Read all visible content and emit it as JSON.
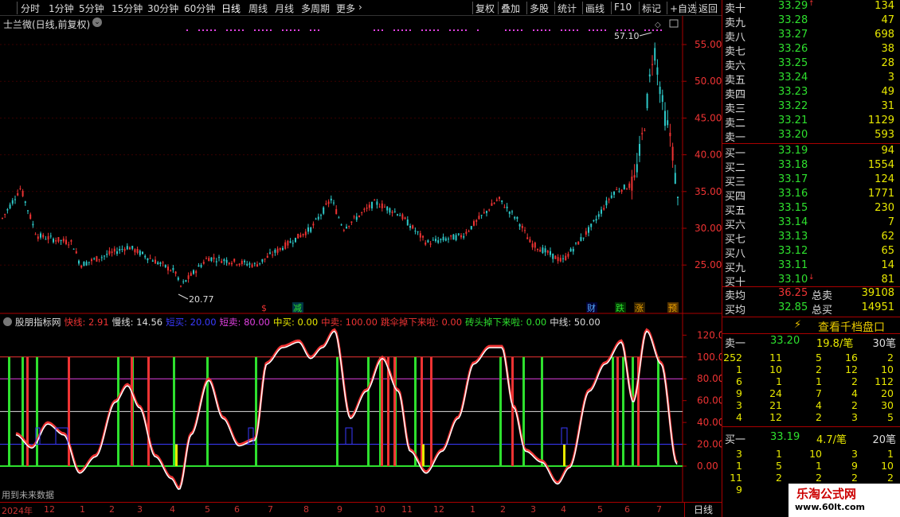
{
  "toolbar": {
    "periods": [
      "分时",
      "1分钟",
      "5分钟",
      "15分钟",
      "30分钟",
      "60分钟",
      "日线",
      "周线",
      "月线",
      "多周期",
      "更多"
    ],
    "active_period": "日线",
    "right_buttons": [
      "复权",
      "叠加",
      "多股",
      "统计",
      "画线",
      "F10",
      "标记",
      "+自选",
      "返回"
    ]
  },
  "main_chart": {
    "title": "士兰微(日线,前复权)",
    "price_ticks": [
      "55.00",
      "50.00",
      "45.00",
      "40.00",
      "35.00",
      "30.00",
      "25.00"
    ],
    "high_label": "57.10",
    "low_label": "20.77",
    "event_markers": [
      "$",
      "减",
      "财",
      "跌",
      "涨",
      "预"
    ]
  },
  "indicator": {
    "name": "股朋指标网",
    "values": [
      {
        "label": "快线:",
        "value": "2.91",
        "color": "#e33"
      },
      {
        "label": "慢线:",
        "value": "14.56",
        "color": "#ddd"
      },
      {
        "label": "短买:",
        "value": "20.00",
        "color": "#3a3aff"
      },
      {
        "label": "短卖:",
        "value": "80.00",
        "color": "#e040e0"
      },
      {
        "label": "中买:",
        "value": "0.00",
        "color": "#e8e800"
      },
      {
        "label": "中卖:",
        "value": "100.00",
        "color": "#e33"
      },
      {
        "label": "跳伞掉下来啦:",
        "value": "0.00",
        "color": "#e33"
      },
      {
        "label": "砖头掉下来啦:",
        "value": "0.00",
        "color": "#2ee02e"
      },
      {
        "label": "中线:",
        "value": "50.00",
        "color": "#ddd"
      }
    ],
    "ticks": [
      "120.00",
      "100.00",
      "80.00",
      "60.00",
      "40.00",
      "20.00",
      "0.00"
    ],
    "future_label": "用到未来数据"
  },
  "x_axis": {
    "labels": [
      "2024年",
      "12",
      "1",
      "2",
      "3",
      "4",
      "5",
      "6",
      "7",
      "8",
      "9",
      "10",
      "11",
      "12",
      "1",
      "2",
      "3",
      "4",
      "5",
      "6",
      "7"
    ],
    "unit": "日线"
  },
  "orderbook": {
    "asks": [
      {
        "label": "卖十",
        "price": "33.29",
        "volume": "134"
      },
      {
        "label": "卖九",
        "price": "33.28",
        "volume": "47"
      },
      {
        "label": "卖八",
        "price": "33.27",
        "volume": "698"
      },
      {
        "label": "卖七",
        "price": "33.26",
        "volume": "38"
      },
      {
        "label": "卖六",
        "price": "33.25",
        "volume": "28"
      },
      {
        "label": "卖五",
        "price": "33.24",
        "volume": "3"
      },
      {
        "label": "卖四",
        "price": "33.23",
        "volume": "49"
      },
      {
        "label": "卖三",
        "price": "33.22",
        "volume": "31"
      },
      {
        "label": "卖二",
        "price": "33.21",
        "volume": "1129"
      },
      {
        "label": "卖一",
        "price": "33.20",
        "volume": "593"
      }
    ],
    "bids": [
      {
        "label": "买一",
        "price": "33.19",
        "volume": "94"
      },
      {
        "label": "买二",
        "price": "33.18",
        "volume": "1554"
      },
      {
        "label": "买三",
        "price": "33.17",
        "volume": "124"
      },
      {
        "label": "买四",
        "price": "33.16",
        "volume": "1771"
      },
      {
        "label": "买五",
        "price": "33.15",
        "volume": "230"
      },
      {
        "label": "买六",
        "price": "33.14",
        "volume": "7"
      },
      {
        "label": "买七",
        "price": "33.13",
        "volume": "62"
      },
      {
        "label": "买八",
        "price": "33.12",
        "volume": "65"
      },
      {
        "label": "买九",
        "price": "33.11",
        "volume": "14"
      },
      {
        "label": "买十",
        "price": "33.10",
        "volume": "81"
      }
    ],
    "ask_marker": "↑",
    "bid_marker": "↓",
    "avg_sell_label": "卖均",
    "avg_sell_price": "36.25",
    "total_sell_label": "总卖",
    "total_sell": "39108",
    "avg_buy_label": "买均",
    "avg_buy_price": "32.85",
    "total_buy_label": "总买",
    "total_buy": "14951"
  },
  "check_button": {
    "label": "查看千档盘口"
  },
  "sell_queue": {
    "label": "卖一",
    "price": "33.20",
    "amount": "19.8/笔",
    "count": "30笔",
    "rows": [
      [
        "252",
        "11",
        "5",
        "16",
        "2"
      ],
      [
        "1",
        "10",
        "2",
        "12",
        "10"
      ],
      [
        "6",
        "1",
        "1",
        "2",
        "112"
      ],
      [
        "9",
        "24",
        "7",
        "4",
        "20"
      ],
      [
        "3",
        "21",
        "4",
        "2",
        "30"
      ],
      [
        "4",
        "12",
        "2",
        "3",
        "5"
      ]
    ]
  },
  "buy_queue": {
    "label": "买一",
    "price": "33.19",
    "amount": "4.7/笔",
    "count": "20笔",
    "rows": [
      [
        "3",
        "1",
        "10",
        "3",
        "1"
      ],
      [
        "1",
        "5",
        "1",
        "9",
        "10"
      ],
      [
        "11",
        "2",
        "2",
        "2",
        "2"
      ],
      [
        "9",
        "",
        "",
        "",
        ""
      ]
    ]
  },
  "watermark": {
    "line1": "乐淘公式网",
    "line2": "www.60lt.com"
  }
}
